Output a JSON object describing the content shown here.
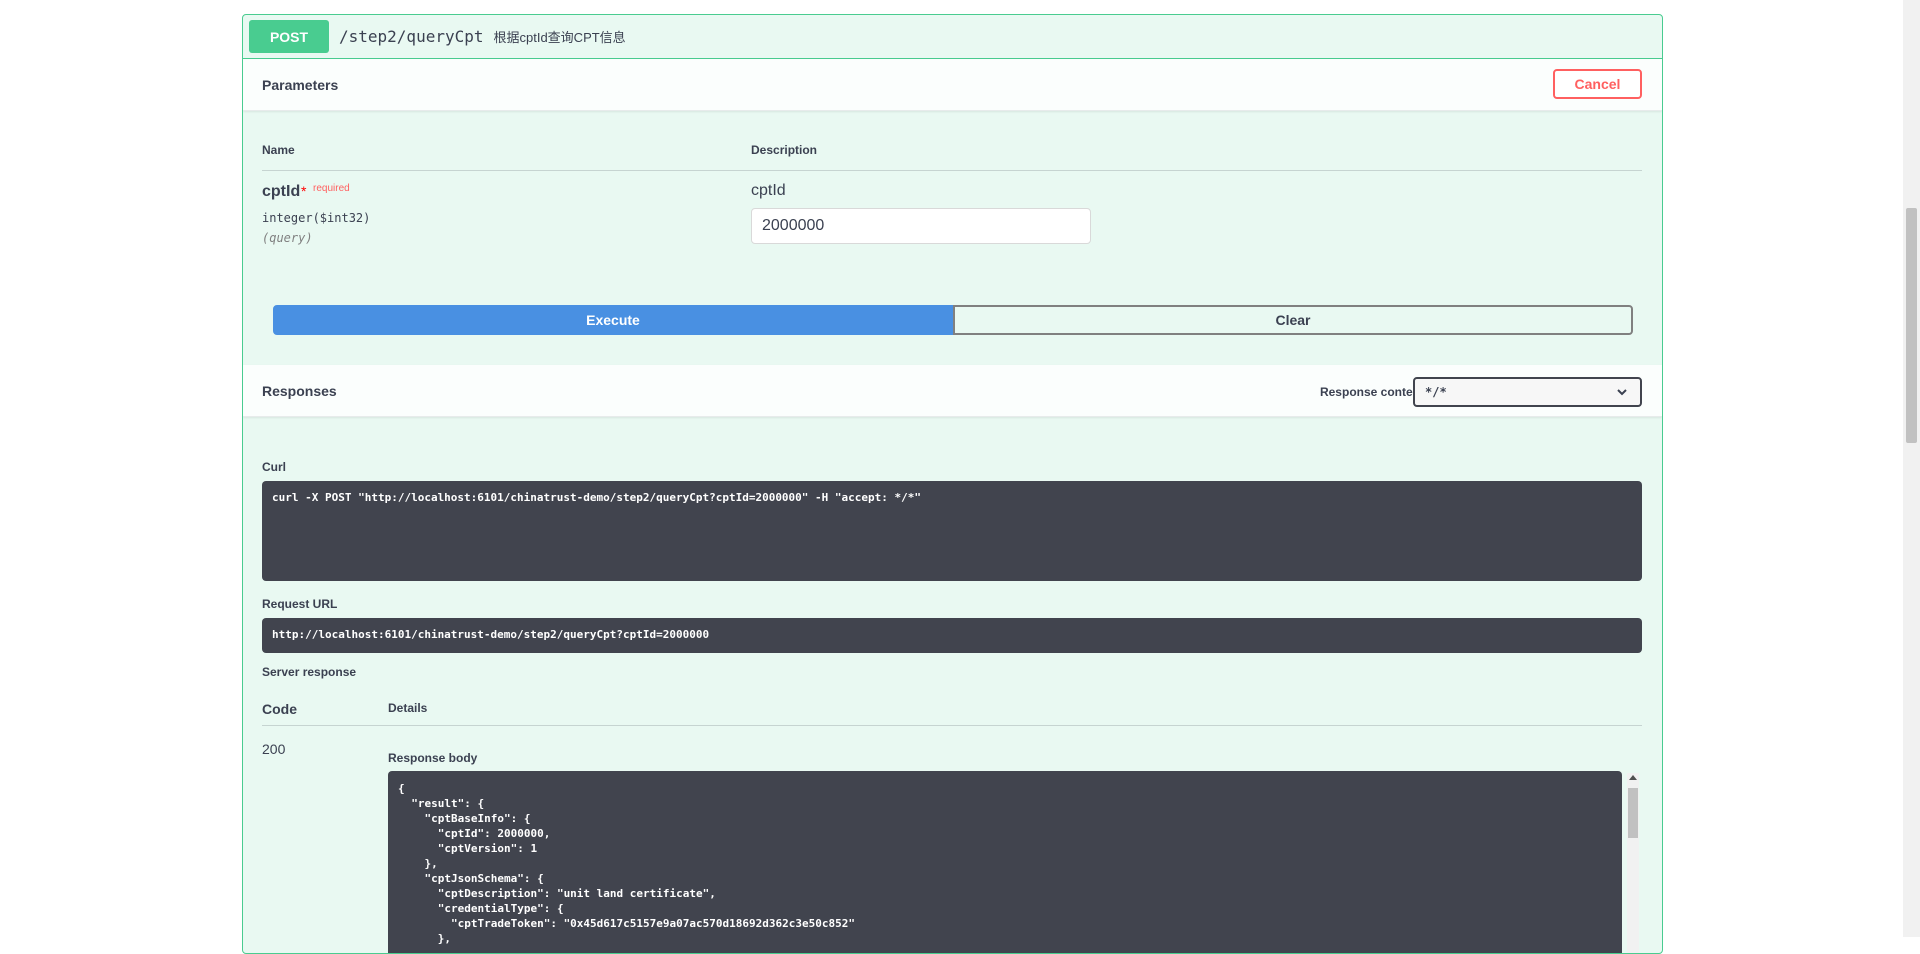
{
  "summary": {
    "method": "POST",
    "path": "/step2/queryCpt",
    "description": "根据cptId查询CPT信息"
  },
  "parameters": {
    "title": "Parameters",
    "cancel_label": "Cancel",
    "col_name": "Name",
    "col_description": "Description",
    "param": {
      "name": "cptId",
      "star": "*",
      "required": "required",
      "type": "integer($int32)",
      "in": "(query)",
      "description": "cptId",
      "value": "2000000"
    },
    "execute_label": "Execute",
    "clear_label": "Clear"
  },
  "responses": {
    "title": "Responses",
    "content_type_label": "Response content type",
    "content_type_value": "*/*",
    "curl_label": "Curl",
    "curl": "curl -X POST \"http://localhost:6101/chinatrust-demo/step2/queryCpt?cptId=2000000\" -H \"accept: */*\"",
    "request_url_label": "Request URL",
    "request_url": "http://localhost:6101/chinatrust-demo/step2/queryCpt?cptId=2000000",
    "server_response_label": "Server response",
    "code_col": "Code",
    "details_col": "Details",
    "code": "200",
    "response_body_label": "Response body",
    "response_body": "{\n  \"result\": {\n    \"cptBaseInfo\": {\n      \"cptId\": 2000000,\n      \"cptVersion\": 1\n    },\n    \"cptJsonSchema\": {\n      \"cptDescription\": \"unit land certificate\",\n      \"credentialType\": {\n        \"cptTradeToken\": \"0x45d617c5157e9a07ac570d18692d362c3e50c852\"\n      },"
  },
  "icons": {
    "select_chevron": "chevron-down-icon"
  }
}
